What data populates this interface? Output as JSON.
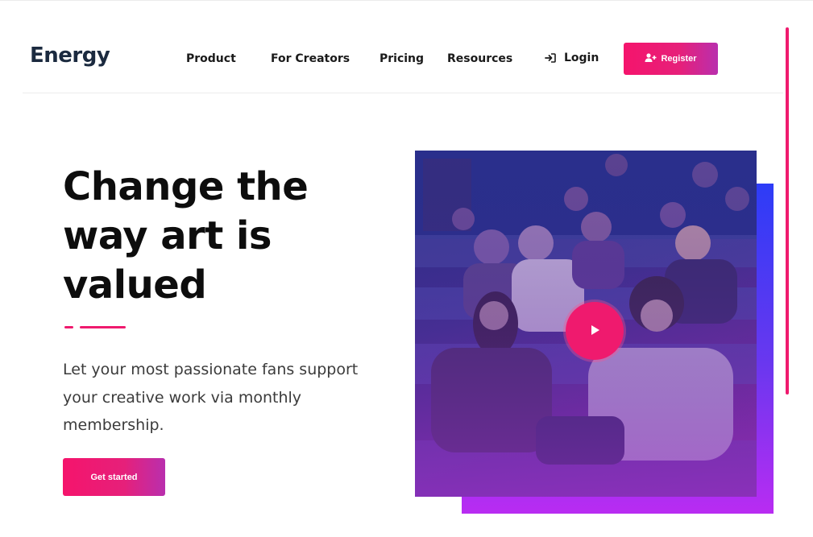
{
  "brand": {
    "logo_text": "Energy",
    "accent": "#ef1a6e"
  },
  "nav": {
    "product": "Product",
    "for_creators": "For Creators",
    "pricing": "Pricing",
    "resources": "Resources",
    "login": "Login",
    "register": "Register"
  },
  "icons": {
    "login": "sign-in-icon",
    "register": "user-plus-icon",
    "play": "play-icon"
  },
  "hero": {
    "headline_line1": "Change the",
    "headline_line2": "way art is",
    "headline_line3": "valued",
    "subtext": "Let your most passionate fans support your creative work via monthly membership.",
    "cta": "Get started"
  },
  "media": {
    "gradient_top": "#2d3cf7",
    "gradient_bottom": "#b92cf2"
  }
}
